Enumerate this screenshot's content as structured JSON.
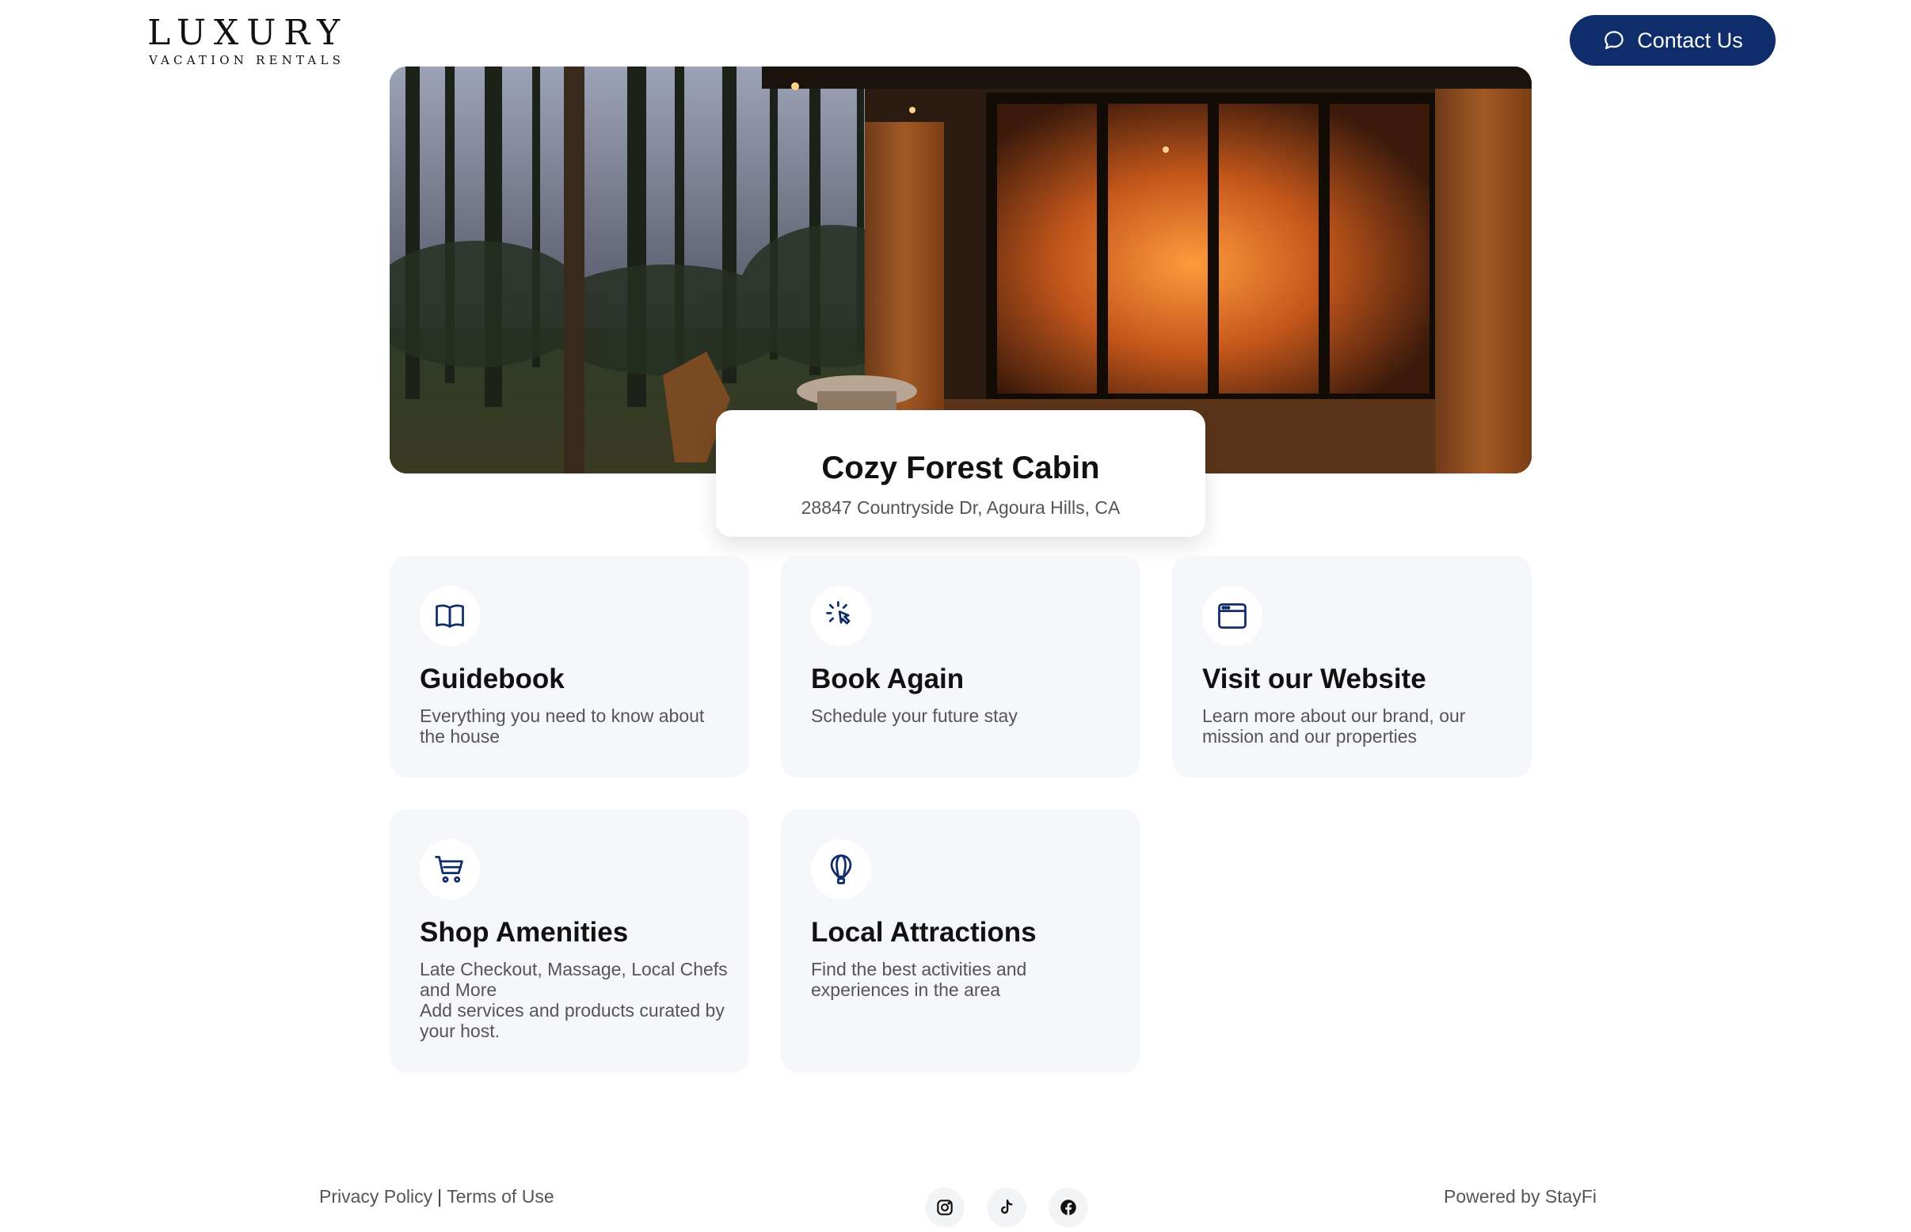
{
  "header": {
    "logo_main": "LUXURY",
    "logo_sub": "VACATION RENTALS",
    "contact_label": "Contact Us"
  },
  "property": {
    "name": "Cozy Forest Cabin",
    "address": "28847 Countryside Dr, Agoura Hills, CA"
  },
  "cards": [
    {
      "icon": "book-icon",
      "title": "Guidebook",
      "description": "Everything you need to know about the house"
    },
    {
      "icon": "cursor-click-icon",
      "title": "Book Again",
      "description": "Schedule your future stay"
    },
    {
      "icon": "browser-window-icon",
      "title": "Visit our Website",
      "description": "Learn more about our brand, our mission and our properties"
    },
    {
      "icon": "shopping-cart-icon",
      "title": "Shop Amenities",
      "description": "Late Checkout, Massage, Local Chefs and More\nAdd services and products curated by your host."
    },
    {
      "icon": "hot-air-balloon-icon",
      "title": "Local Attractions",
      "description": "Find the best activities and experiences in the area"
    }
  ],
  "footer": {
    "privacy": "Privacy Policy",
    "separator": "|",
    "terms": "Terms of Use",
    "powered_by": "Powered by StayFi",
    "social": [
      "instagram-icon",
      "tiktok-icon",
      "facebook-icon"
    ]
  },
  "colors": {
    "brand_navy": "#0f2d6b",
    "card_bg": "#f6f7fa",
    "icon_stroke": "#0f2d6b"
  }
}
